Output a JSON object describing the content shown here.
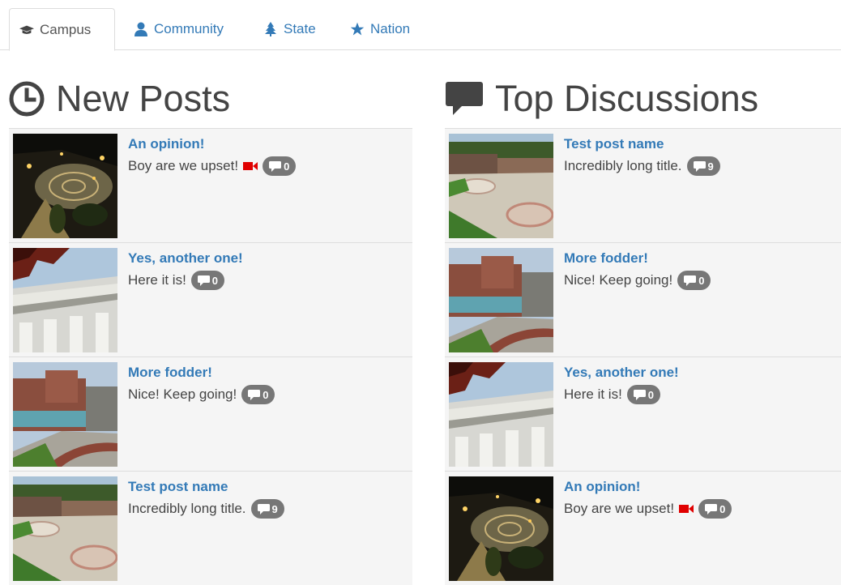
{
  "tabs": [
    {
      "label": "Campus",
      "icon": "graduation-cap-icon",
      "active": true
    },
    {
      "label": "Community",
      "icon": "user-icon",
      "active": false
    },
    {
      "label": "State",
      "icon": "tree-icon",
      "active": false
    },
    {
      "label": "Nation",
      "icon": "star-icon",
      "active": false
    }
  ],
  "new_posts": {
    "title": "New Posts",
    "icon": "clock-icon",
    "items": [
      {
        "title": "An opinion!",
        "desc": "Boy are we upset!",
        "video": true,
        "comments": "0",
        "thumb": "plaza-night"
      },
      {
        "title": "Yes, another one!",
        "desc": "Here it is!",
        "video": false,
        "comments": "0",
        "thumb": "building-facade"
      },
      {
        "title": "More fodder!",
        "desc": "Nice! Keep going!",
        "video": false,
        "comments": "0",
        "thumb": "brick-building"
      },
      {
        "title": "Test post name",
        "desc": "Incredibly long title.",
        "video": false,
        "comments": "9",
        "thumb": "plaza-day"
      }
    ]
  },
  "top_discussions": {
    "title": "Top Discussions",
    "icon": "comment-icon",
    "items": [
      {
        "title": "Test post name",
        "desc": "Incredibly long title.",
        "video": false,
        "comments": "9",
        "thumb": "plaza-day"
      },
      {
        "title": "More fodder!",
        "desc": "Nice! Keep going!",
        "video": false,
        "comments": "0",
        "thumb": "brick-building"
      },
      {
        "title": "Yes, another one!",
        "desc": "Here it is!",
        "video": false,
        "comments": "0",
        "thumb": "building-facade"
      },
      {
        "title": "An opinion!",
        "desc": "Boy are we upset!",
        "video": true,
        "comments": "0",
        "thumb": "plaza-night"
      }
    ]
  },
  "colors": {
    "link": "#337ab7",
    "badge": "#777777",
    "video": "#e00000",
    "row_bg": "#f5f5f5"
  }
}
